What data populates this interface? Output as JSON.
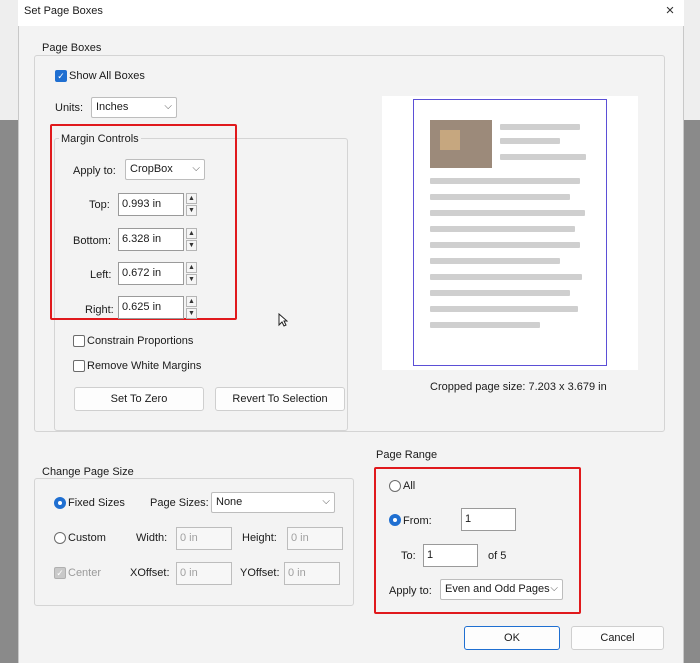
{
  "window": {
    "title": "Set Page Boxes",
    "close_icon": "×"
  },
  "page_boxes": {
    "group_label": "Page Boxes",
    "show_all_boxes": {
      "label": "Show All Boxes",
      "checked": true
    },
    "units_label": "Units:",
    "units_value": "Inches"
  },
  "margin_controls": {
    "group_label": "Margin Controls",
    "apply_to_label": "Apply to:",
    "apply_to_value": "CropBox",
    "fields": [
      {
        "label": "Top:",
        "value": "0.993 in"
      },
      {
        "label": "Bottom:",
        "value": "6.328 in"
      },
      {
        "label": "Left:",
        "value": "0.672 in"
      },
      {
        "label": "Right:",
        "value": "0.625 in"
      }
    ],
    "constrain_label": "Constrain Proportions",
    "remove_white_label": "Remove White Margins",
    "set_to_zero_label": "Set To Zero",
    "revert_label": "Revert To Selection"
  },
  "preview": {
    "cropped_size_text": "Cropped page size: 7.203 x 3.679 in"
  },
  "change_page_size": {
    "group_label": "Change Page Size",
    "fixed_sizes_label": "Fixed Sizes",
    "custom_label": "Custom",
    "page_sizes_label": "Page Sizes:",
    "page_sizes_value": "None",
    "width_label": "Width:",
    "width_value": "0 in",
    "height_label": "Height:",
    "height_value": "0 in",
    "center_label": "Center",
    "xoffset_label": "XOffset:",
    "xoffset_value": "0 in",
    "yoffset_label": "YOffset:",
    "yoffset_value": "0 in"
  },
  "page_range": {
    "group_label": "Page Range",
    "all_label": "All",
    "from_label": "From:",
    "from_value": "1",
    "to_label": "To:",
    "to_value": "1",
    "of_text": "of 5",
    "apply_to_label": "Apply to:",
    "apply_to_value": "Even and Odd Pages"
  },
  "buttons": {
    "ok": "OK",
    "cancel": "Cancel"
  },
  "colors": {
    "accent": "#1f6fd1",
    "highlight": "#e0191c"
  }
}
